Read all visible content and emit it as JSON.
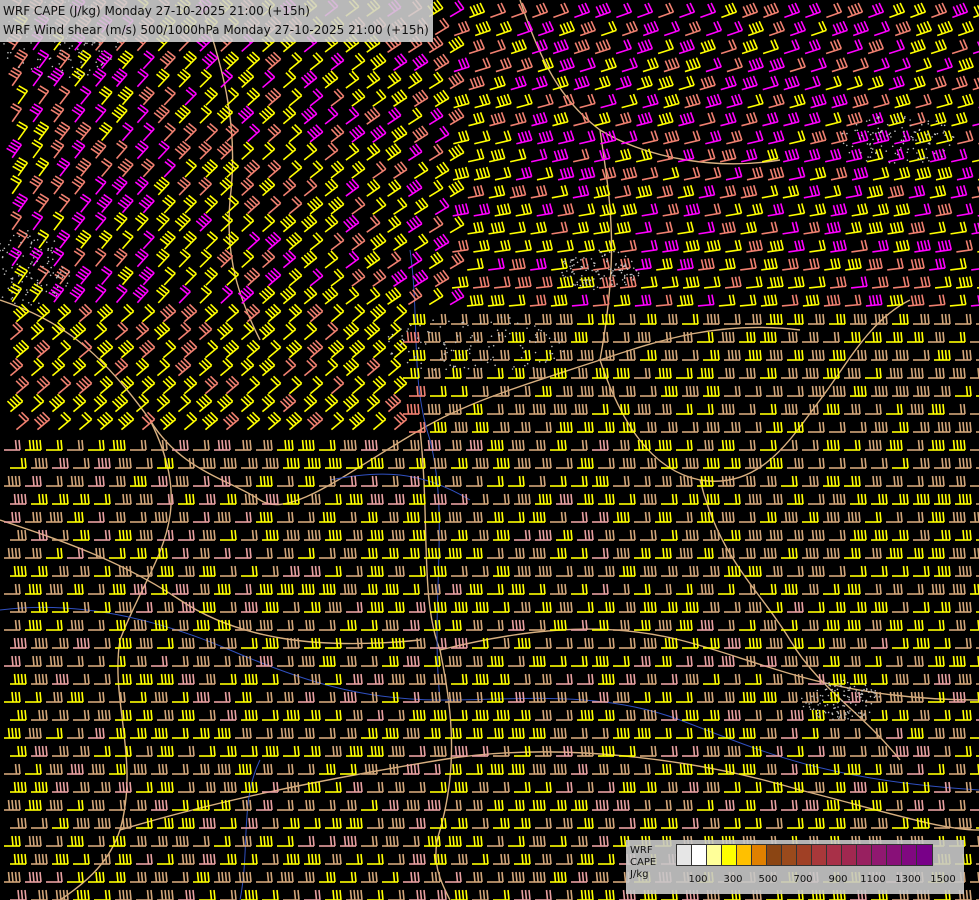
{
  "header": {
    "line1": "WRF CAPE (J/kg) Monday 27-10-2025 21:00 (+15h)",
    "line2": "WRF Wind shear (m/s) 500/1000hPa Monday 27-10-2025 21:00 (+15h)"
  },
  "legend": {
    "title_lines": [
      "WRF",
      "CAPE",
      "J/kg"
    ],
    "swatch_colors": [
      "#e6e6e6",
      "#ffffff",
      "#ffff99",
      "#ffff00",
      "#ffc000",
      "#e08000",
      "#8b4513",
      "#9a4a1c",
      "#a04025",
      "#a8383a",
      "#a83048",
      "#a02850",
      "#982060",
      "#901870",
      "#881078",
      "#800880",
      "#780088"
    ],
    "tick_labels": [
      "100",
      "300",
      "500",
      "700",
      "900",
      "1100",
      "1300",
      "1500"
    ]
  },
  "colors": {
    "background": "#000000",
    "barb_yellow": "#ffff00",
    "barb_magenta": "#ff00ff",
    "barb_salmon": "#f08070",
    "barb_tan": "#d2a679",
    "barb_pink": "#e8a0a0",
    "border_line": "#d8b080",
    "river_line": "#3050c0"
  }
}
